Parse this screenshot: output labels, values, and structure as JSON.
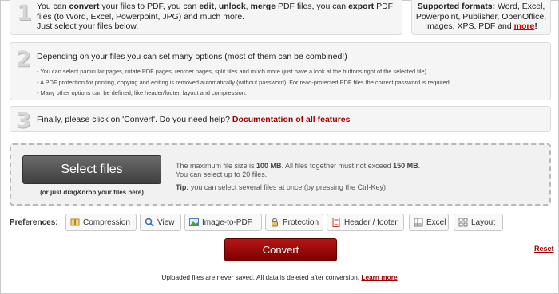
{
  "step1": {
    "number": "1",
    "line1_pre": "You can ",
    "line1_convert": "convert",
    "line1_mid1": " your files to PDF, you can ",
    "line1_edit": "edit",
    "line1_mid2": ", ",
    "line1_unlock": "unlock",
    "line1_mid3": ", ",
    "line1_merge": "merge",
    "line1_mid4": " PDF files, you can ",
    "line1_export": "export",
    "line1_post": " PDF files (to Word, Excel, Powerpoint, JPG) and much more.",
    "line2": "Just select your files below."
  },
  "formats": {
    "label": "Supported formats:",
    "list": " Word, Excel, Powerpoint, Publisher, OpenOffice, Images, XPS, PDF and ",
    "more_link": "more",
    "more_suffix": "!"
  },
  "step2": {
    "number": "2",
    "title": "Depending on your files you can set many options (most of them can be combined!)",
    "bullets": [
      "- You can select particular pages, rotate PDF pages, reorder pages, split files and much more (just have a look at the buttons right of the selected file)",
      "- A PDF protection for printing, copying and editing is removed automatically (without password). For read-protected PDF files the correct password is required.",
      "- Many other options can be defined, like header/footer, layout and compression."
    ]
  },
  "step3": {
    "number": "3",
    "text": "Finally, please click on 'Convert'. Do you need help? ",
    "link": "Documentation of all features"
  },
  "upload": {
    "select_button": "Select files",
    "drag_hint": "(or just drag&drop your files here)",
    "max_size_pre": "The maximum file size is ",
    "max_size_value": "100 MB",
    "max_size_mid": ". All files together must not exceed ",
    "max_total_value": "150 MB",
    "max_size_post": ".",
    "max_files": "You can select up to 20 files.",
    "tip_label": "Tip:",
    "tip_text": " you can select several files at once (by pressing the Ctrl-Key)"
  },
  "preferences": {
    "label": "Preferences:",
    "buttons": [
      {
        "label": "Compression",
        "icon": "compression-icon"
      },
      {
        "label": "View",
        "icon": "magnifier-icon"
      },
      {
        "label": "Image-to-PDF",
        "icon": "image-icon"
      },
      {
        "label": "Protection",
        "icon": "lock-icon"
      },
      {
        "label": "Header / footer",
        "icon": "document-icon"
      },
      {
        "label": "Excel",
        "icon": "spreadsheet-icon"
      },
      {
        "label": "Layout",
        "icon": "layout-grid-icon"
      }
    ]
  },
  "actions": {
    "convert": "Convert",
    "reset": "Reset"
  },
  "footer": {
    "text": "Uploaded files are never saved. All data is deleted after conversion. ",
    "link": "Learn more"
  },
  "colors": {
    "accent_red": "#a00000",
    "convert_button": "#9b0a0a",
    "select_button": "#555555"
  }
}
